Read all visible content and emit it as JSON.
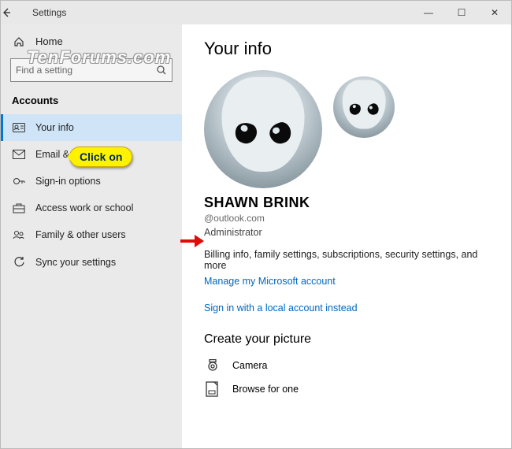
{
  "window": {
    "title": "Settings",
    "min": "—",
    "max": "☐",
    "close": "✕"
  },
  "sidebar": {
    "home": "Home",
    "search_placeholder": "Find a setting",
    "section": "Accounts",
    "items": [
      {
        "label": "Your info"
      },
      {
        "label": "Email & accounts"
      },
      {
        "label": "Sign-in options"
      },
      {
        "label": "Access work or school"
      },
      {
        "label": "Family & other users"
      },
      {
        "label": "Sync your settings"
      }
    ]
  },
  "main": {
    "heading": "Your info",
    "user_name": "SHAWN BRINK",
    "user_email": "@outlook.com",
    "user_role": "Administrator",
    "billing_desc": "Billing info, family settings, subscriptions, security settings, and more",
    "manage_link": "Manage my Microsoft account",
    "local_link": "Sign in with a local account instead",
    "picture_heading": "Create your picture",
    "camera_label": "Camera",
    "browse_label": "Browse for one"
  },
  "annotations": {
    "callout": "Click on",
    "watermark": "TenForums.com"
  }
}
